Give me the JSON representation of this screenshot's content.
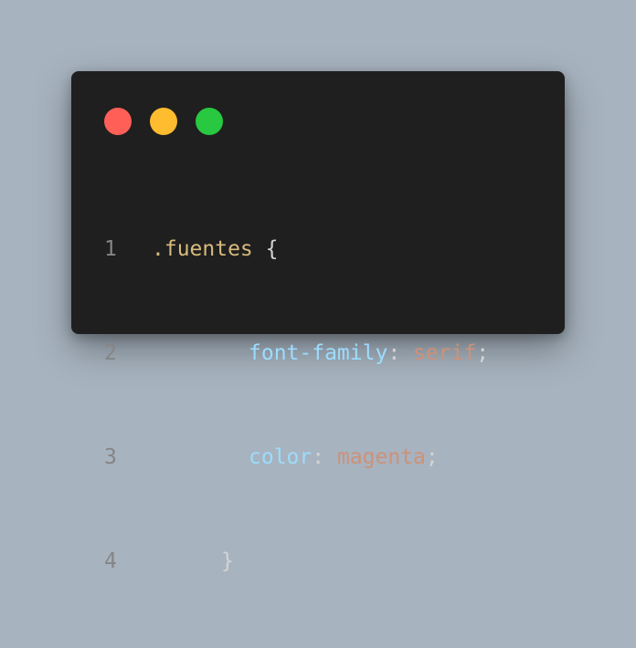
{
  "colors": {
    "background": "#a7b3bf",
    "window": "#1f1f1f",
    "close_dot": "#ff5f57",
    "minimize_dot": "#febc2e",
    "maximize_dot": "#28c840",
    "selector": "#d7ba7d",
    "property": "#9cdcfe",
    "value": "#ce9178",
    "line_number": "#858585"
  },
  "window_controls": [
    {
      "name": "close-dot",
      "color": "#ff5f57"
    },
    {
      "name": "minimize-dot",
      "color": "#febc2e"
    },
    {
      "name": "maximize-dot",
      "color": "#28c840"
    }
  ],
  "code": {
    "lines": [
      {
        "number": "1",
        "selector": ".fuentes",
        "brace": "{"
      },
      {
        "number": "2",
        "property": "font-family",
        "colon": ":",
        "value": "serif",
        "semicolon": ";"
      },
      {
        "number": "3",
        "property": "color",
        "colon": ":",
        "value": "magenta",
        "semicolon": ";"
      },
      {
        "number": "4",
        "brace": "}"
      }
    ]
  }
}
